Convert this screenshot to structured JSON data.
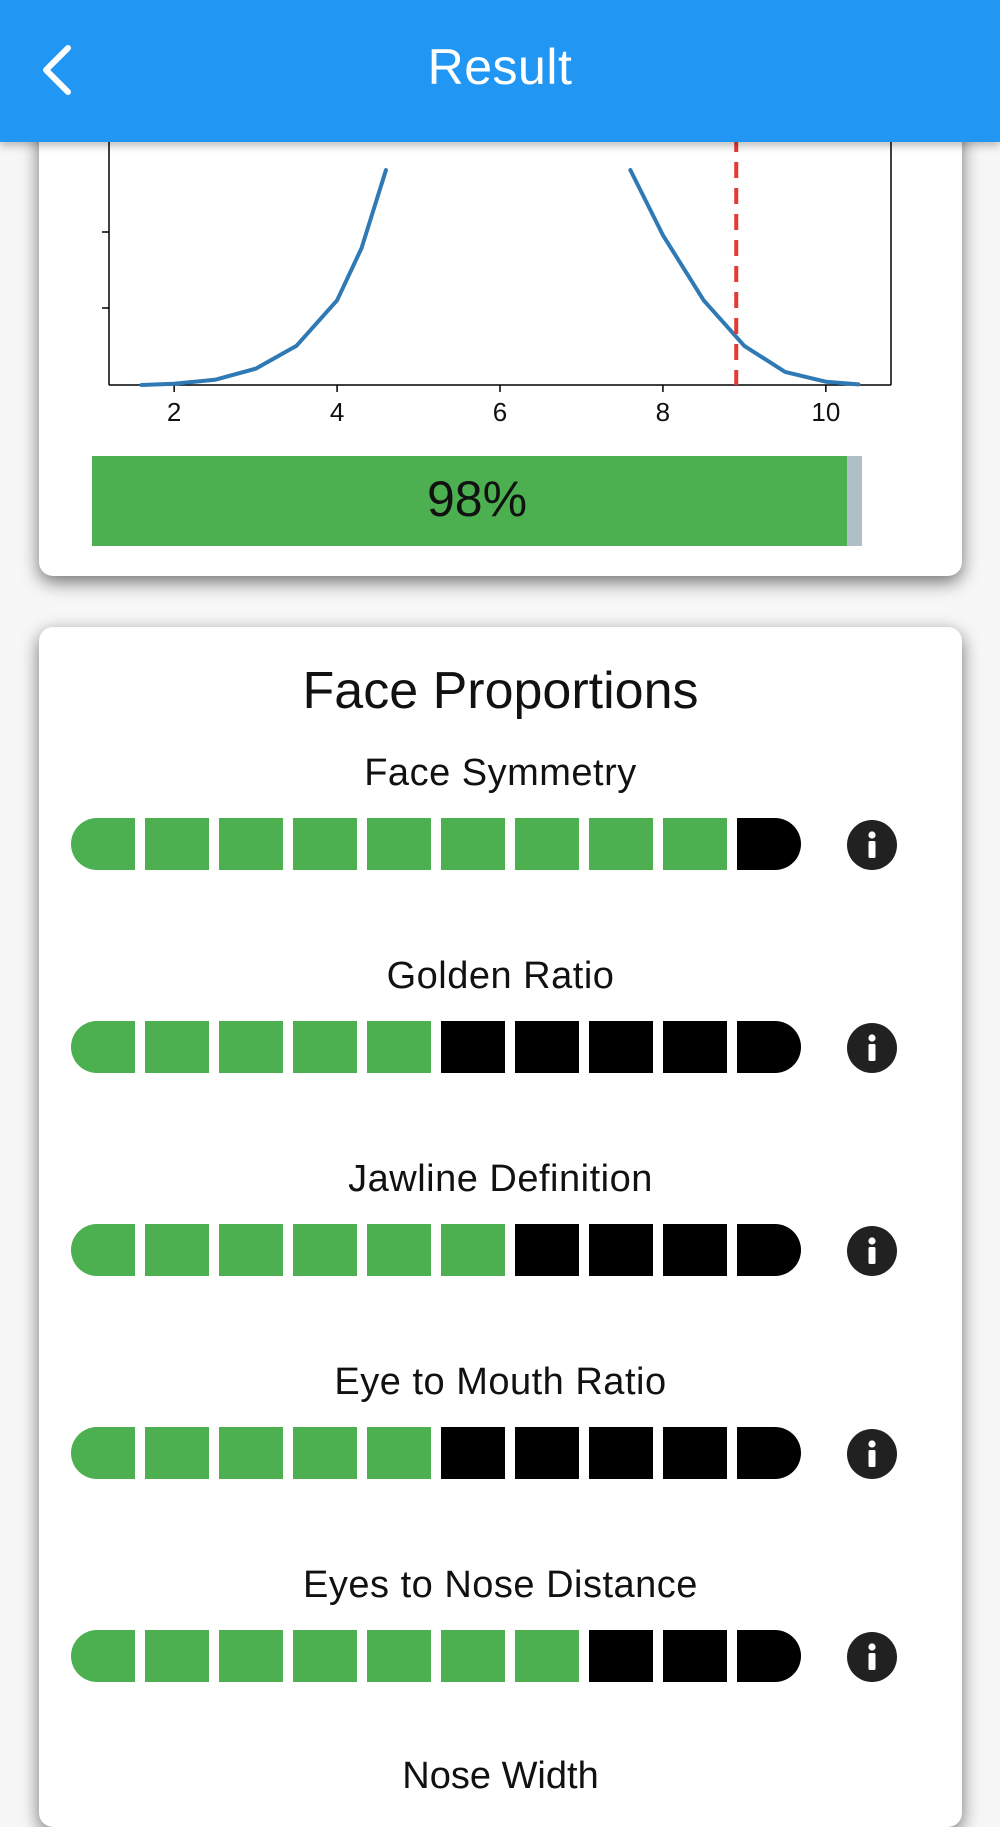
{
  "appbar": {
    "title": "Result",
    "back_icon": "chevron-left-icon"
  },
  "score_card": {
    "chart_data": {
      "type": "line",
      "xlim": [
        1.2,
        10.8
      ],
      "xticks": [
        "2",
        "4",
        "6",
        "8",
        "10"
      ],
      "series": [
        {
          "x": [
            1.6,
            2.0,
            2.5,
            3.0,
            3.5,
            4.0,
            4.3,
            4.6
          ],
          "y": [
            0.0,
            0.002,
            0.008,
            0.025,
            0.06,
            0.13,
            0.21,
            0.33
          ]
        },
        {
          "x": [
            7.6,
            8.0,
            8.5,
            9.0,
            9.5,
            10.0,
            10.4
          ],
          "y": [
            0.33,
            0.23,
            0.13,
            0.06,
            0.02,
            0.005,
            0.001
          ]
        }
      ],
      "marker_line": {
        "x": 8.9,
        "color": "#e53935",
        "style": "dashed"
      },
      "line_color": "#2f7ab5"
    },
    "progress": {
      "value": 0.98,
      "label": "98%",
      "fill_color": "#4caf50",
      "track_color": "#b0bec5"
    }
  },
  "face_proportions": {
    "title": "Face Proportions",
    "segments_total": 10,
    "active_color": "#4caf50",
    "inactive_color": "#000000",
    "info_icon": "info-icon",
    "metrics": [
      {
        "name": "Face Symmetry",
        "filled": 9
      },
      {
        "name": "Golden Ratio",
        "filled": 5
      },
      {
        "name": "Jawline Definition",
        "filled": 6
      },
      {
        "name": "Eye to Mouth Ratio",
        "filled": 5
      },
      {
        "name": "Eyes to Nose Distance",
        "filled": 7
      }
    ],
    "next_metric": {
      "name": "Nose Width"
    }
  }
}
